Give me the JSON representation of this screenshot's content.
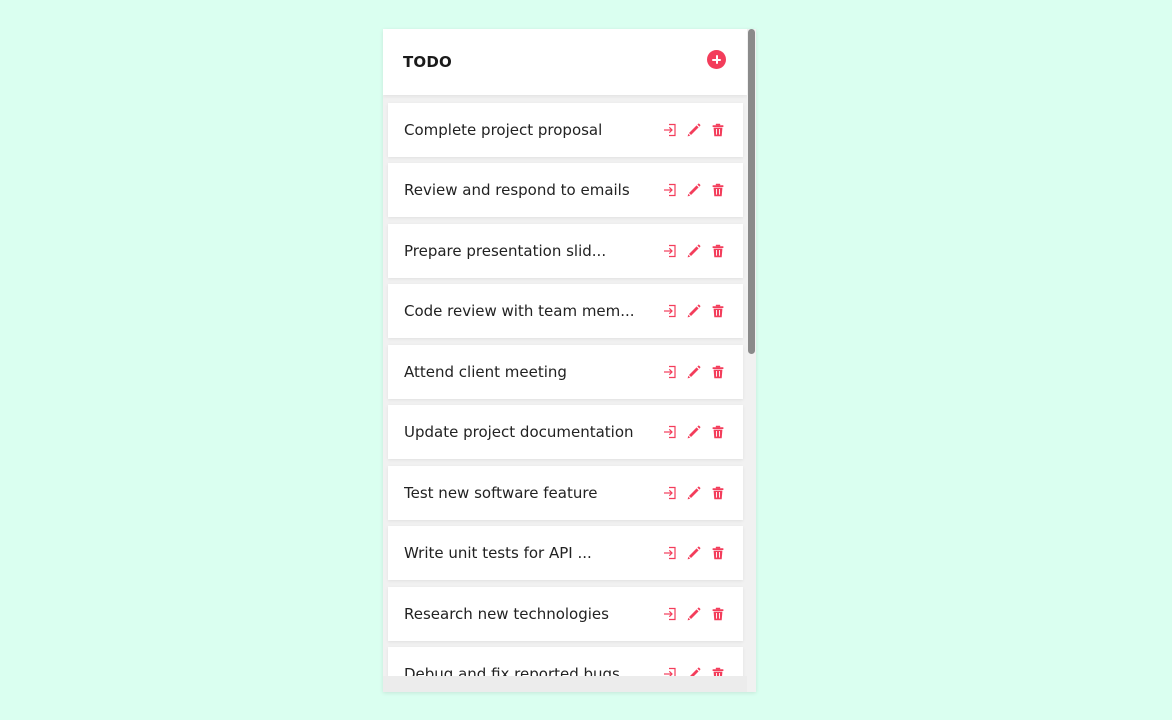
{
  "header": {
    "title": "TODO",
    "add_icon": "plus-circle-icon"
  },
  "colors": {
    "background": "#dafff0",
    "accent": "#f33d5b"
  },
  "item_icons": [
    "enter-icon",
    "pencil-icon",
    "trash-icon"
  ],
  "items": [
    {
      "label": "Complete project proposal"
    },
    {
      "label": "Review and respond to emails"
    },
    {
      "label": "Prepare presentation slid..."
    },
    {
      "label": "Code review with team mem..."
    },
    {
      "label": "Attend client meeting"
    },
    {
      "label": "Update project documentation"
    },
    {
      "label": "Test new software feature"
    },
    {
      "label": "Write unit tests for API ..."
    },
    {
      "label": "Research new technologies"
    },
    {
      "label": "Debug and fix reported bugs"
    }
  ]
}
